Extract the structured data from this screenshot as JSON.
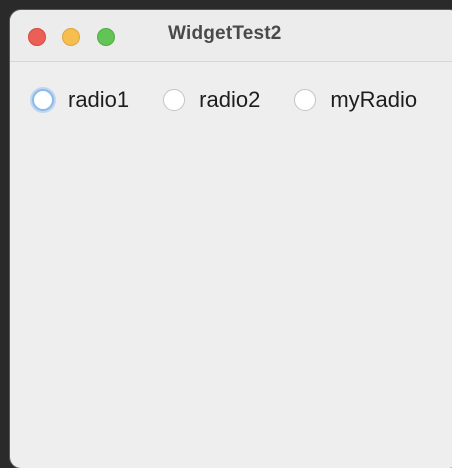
{
  "window": {
    "title": "WidgetTest2",
    "buttons": [
      "close-icon",
      "minimize-icon",
      "zoom-icon"
    ]
  },
  "radios": [
    {
      "label": "radio1",
      "selected": false,
      "focused": true
    },
    {
      "label": "radio2",
      "selected": false,
      "focused": false
    },
    {
      "label": "myRadio",
      "selected": false,
      "focused": false
    }
  ],
  "colors": {
    "close": "#ec5f57",
    "minimize": "#f6be4f",
    "zoom": "#61c454",
    "focus_ring": "#8ab9ee",
    "window_bg": "#eeeeee"
  }
}
